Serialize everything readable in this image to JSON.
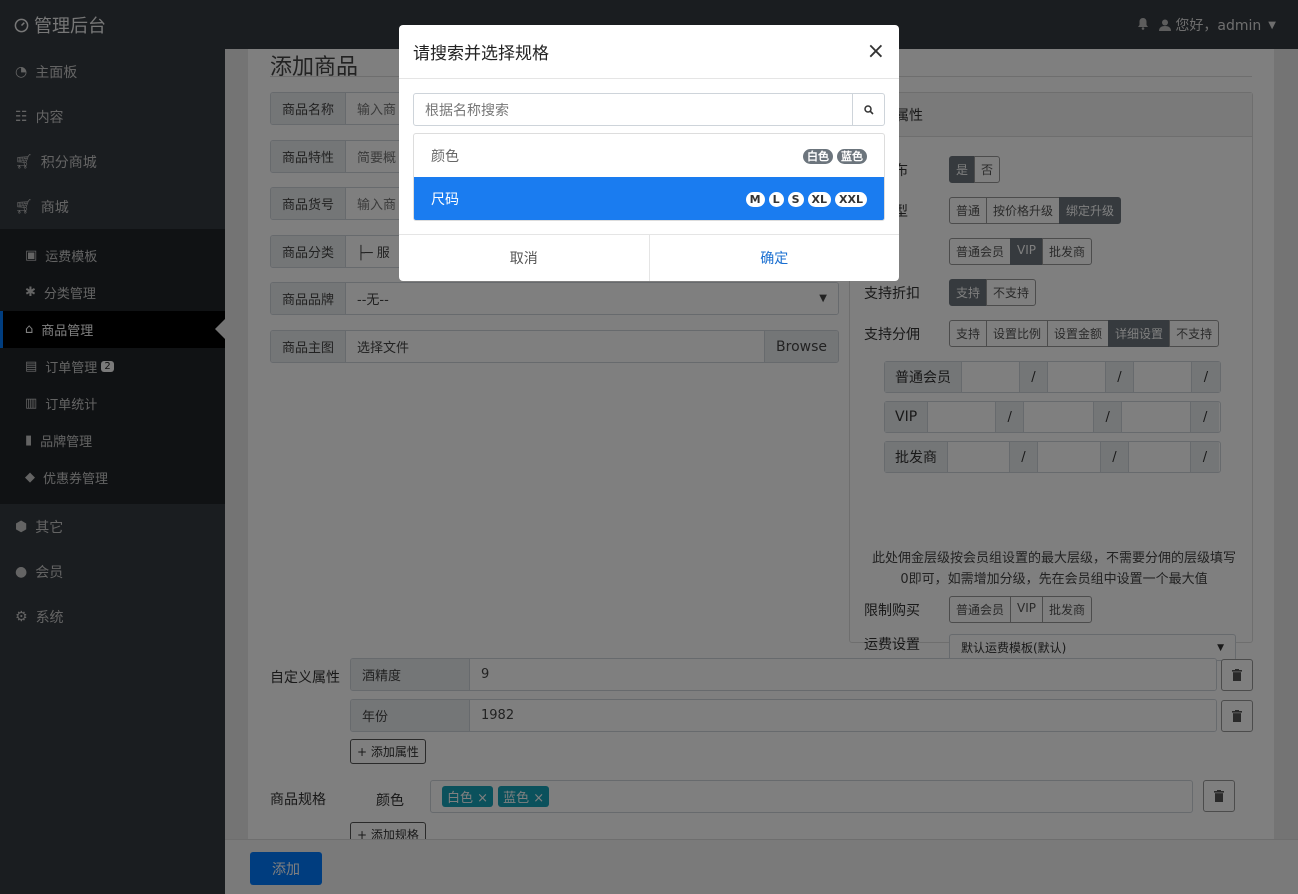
{
  "header": {
    "brand": "管理后台",
    "greeting": "您好，admin"
  },
  "sidebar": {
    "top": [
      {
        "label": "主面板"
      },
      {
        "label": "内容"
      },
      {
        "label": "积分商城"
      },
      {
        "label": "商城"
      }
    ],
    "sub": [
      {
        "label": "运费模板"
      },
      {
        "label": "分类管理"
      },
      {
        "label": "商品管理"
      },
      {
        "label": "订单管理",
        "badge": "2"
      },
      {
        "label": "订单统计"
      },
      {
        "label": "品牌管理"
      },
      {
        "label": "优惠券管理"
      }
    ],
    "bottom": [
      {
        "label": "其它"
      },
      {
        "label": "会员"
      },
      {
        "label": "系统"
      }
    ]
  },
  "page": {
    "title": "添加商品"
  },
  "form": {
    "name": {
      "label": "商品名称",
      "placeholder": "输入商"
    },
    "feature": {
      "label": "商品特性",
      "placeholder": "简要概"
    },
    "sku": {
      "label": "商品货号",
      "placeholder": "输入商"
    },
    "category": {
      "label": "商品分类",
      "value": "├─ 服"
    },
    "brand": {
      "label": "商品品牌",
      "value": "--无--"
    },
    "image": {
      "label": "商品主图",
      "value": "选择文件",
      "browse": "Browse"
    }
  },
  "attrs": {
    "title": "属性",
    "publish": {
      "label": "发布",
      "options": [
        "是",
        "否"
      ]
    },
    "type": {
      "label": "类型",
      "options": [
        "普通",
        "按价格升级",
        "绑定升级"
      ]
    },
    "level": {
      "options": [
        "普通会员",
        "VIP",
        "批发商"
      ]
    },
    "discount": {
      "label": "支持折扣",
      "options": [
        "支持",
        "不支持"
      ]
    },
    "commission": {
      "label": "支持分佣",
      "options": [
        "支持",
        "设置比例",
        "设置金额",
        "详细设置",
        "不支持"
      ]
    },
    "comm_rows": [
      {
        "label": "普通会员"
      },
      {
        "label": "VIP"
      },
      {
        "label": "批发商"
      }
    ],
    "slash": "/",
    "note": "此处佣金层级按会员组设置的最大层级，不需要分佣的层级填写0即可，如需增加分级，先在会员组中设置一个最大值",
    "limit": {
      "label": "限制购买",
      "options": [
        "普通会员",
        "VIP",
        "批发商"
      ]
    },
    "shipping": {
      "label": "运费设置",
      "value": "默认运费模板(默认)"
    }
  },
  "custom": {
    "label": "自定义属性",
    "rows": [
      {
        "key": "酒精度",
        "value": "9"
      },
      {
        "key": "年份",
        "value": "1982"
      }
    ],
    "add": "+ 添加属性"
  },
  "spec": {
    "label": "商品规格",
    "name": "颜色",
    "tags": [
      "白色",
      "蓝色"
    ],
    "add": "+ 添加规格"
  },
  "footer": {
    "submit": "添加"
  },
  "modal": {
    "title": "请搜索并选择规格",
    "close": "×",
    "search_placeholder": "根据名称搜索",
    "items": [
      {
        "name": "颜色",
        "values": [
          "白色",
          "蓝色"
        ]
      },
      {
        "name": "尺码",
        "values": [
          "M",
          "L",
          "S",
          "XL",
          "XXL"
        ]
      }
    ],
    "cancel": "取消",
    "confirm": "确定"
  }
}
